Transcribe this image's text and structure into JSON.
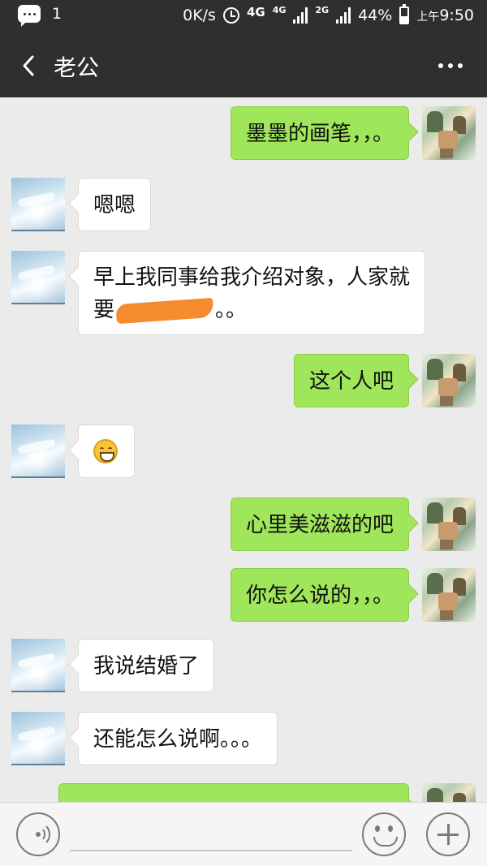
{
  "status_bar": {
    "notification_count": "1",
    "net_speed": "0K/s",
    "net_type_1": "4G",
    "net_type_2": "4G",
    "net_type_3": "2G",
    "battery": "44%",
    "time_prefix": "上午",
    "time": "9:50",
    "icons": [
      "message-icon",
      "alarm-icon",
      "signal-icon",
      "battery-icon"
    ]
  },
  "header": {
    "title": "老公",
    "back_icon": "chevron-left-icon",
    "more_icon": "more-icon"
  },
  "messages": [
    {
      "sender": "self",
      "text": "墨墨的画笔，，。"
    },
    {
      "sender": "other",
      "text": "嗯嗯"
    },
    {
      "sender": "other",
      "text_line1": "早上我同事给我介绍对象，人家就",
      "text_line2_prefix": "要",
      "text_line2_suffix": "。。",
      "redacted": true
    },
    {
      "sender": "self",
      "text": "这个人吧"
    },
    {
      "sender": "other",
      "emoji": "grinning-face-emoji"
    },
    {
      "sender": "self",
      "text": "心里美滋滋的吧"
    },
    {
      "sender": "self",
      "text": "你怎么说的，，。"
    },
    {
      "sender": "other",
      "text": "我说结婚了"
    },
    {
      "sender": "other",
      "text": "还能怎么说啊。。。"
    },
    {
      "sender": "self",
      "text": ""
    }
  ],
  "input_bar": {
    "value": "",
    "voice_icon": "voice-icon",
    "emoji_icon": "emoji-icon",
    "plus_icon": "plus-icon"
  },
  "colors": {
    "header_bg": "#2f2f2f",
    "chat_bg": "#ebebeb",
    "self_bubble": "#9fe65a",
    "other_bubble": "#ffffff"
  }
}
